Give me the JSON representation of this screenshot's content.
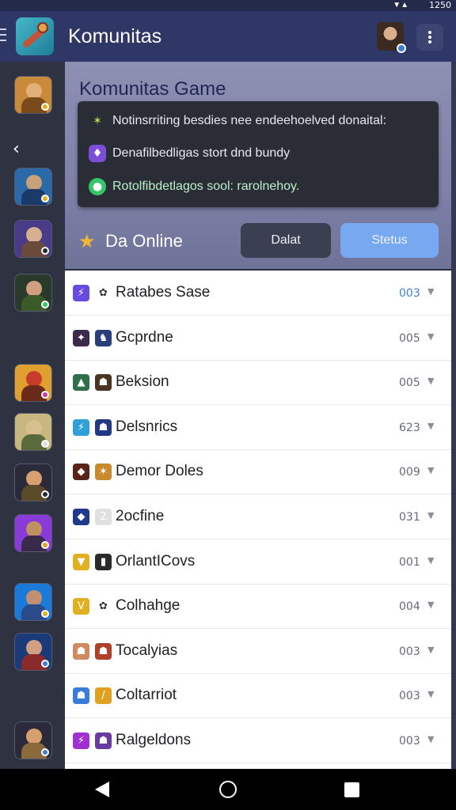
{
  "status_bar": {
    "time": "1250"
  },
  "app_bar": {
    "title": "Komunitas"
  },
  "community": {
    "title": "Komunitas Game",
    "notices": [
      {
        "icon": "sparkle-icon",
        "color": "#8fbf3a",
        "text": "Notinsrriting besdies nee endeehoelved donaital:"
      },
      {
        "icon": "shield-icon",
        "color": "#7b4fd8",
        "text": "Denafilbedligas stort dnd bundy"
      },
      {
        "icon": "chat-bubble-icon",
        "color": "#34c76a",
        "text": "Rotolfibdetlagos sool: rarolnehoy."
      }
    ],
    "online_label": "Da Online",
    "buttons": {
      "dalat": "Dalat",
      "status": "Stetus"
    }
  },
  "members": [
    {
      "name": "Ratabes Sase",
      "count": "003",
      "highlight": true
    },
    {
      "name": "Gcprdne",
      "count": "005"
    },
    {
      "name": "Beksion",
      "count": "005"
    },
    {
      "name": "Delsnrics",
      "count": "623"
    },
    {
      "name": "Demor Doles",
      "count": "009"
    },
    {
      "name": "2ocfine",
      "count": "031"
    },
    {
      "name": "OrlantICovs",
      "count": "001"
    },
    {
      "name": "Colhahge",
      "count": "004"
    },
    {
      "name": "Tocalyias",
      "count": "003"
    },
    {
      "name": "Coltarriot",
      "count": "003"
    },
    {
      "name": "Ralgeldons",
      "count": "003"
    }
  ],
  "colors": {
    "app_bar": "#2e3766",
    "accent_blue": "#78a8f0",
    "star": "#f2b632"
  }
}
